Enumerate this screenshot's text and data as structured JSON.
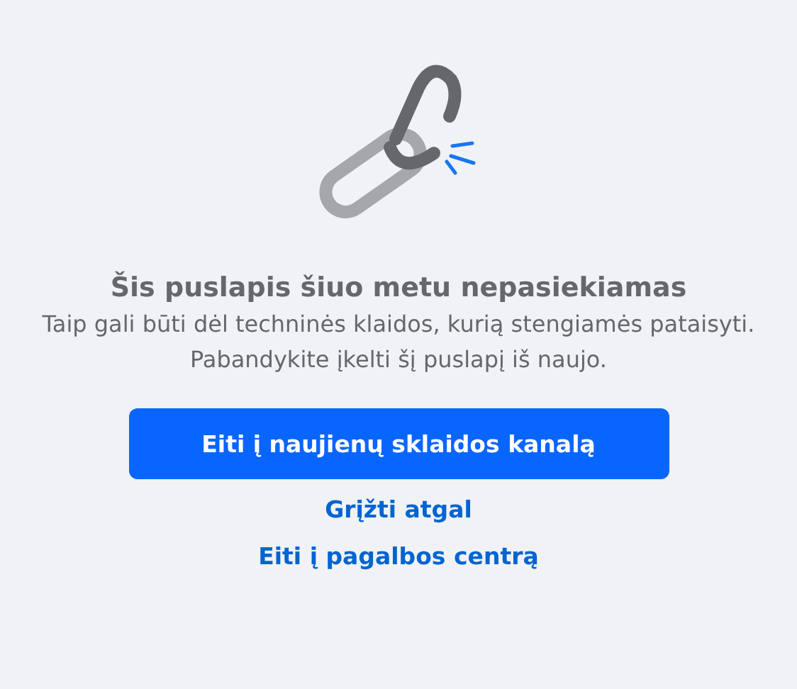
{
  "title": "Šis puslapis šiuo metu nepasiekiamas",
  "message": "Taip gali būti dėl techninės klaidos, kurią stengiamės pataisyti. Pabandykite įkelti šį puslapį iš naujo.",
  "primary_button": "Eiti į naujienų sklaidos kanalą",
  "links": [
    "Grįžti atgal",
    "Eiti į pagalbos centrą"
  ]
}
